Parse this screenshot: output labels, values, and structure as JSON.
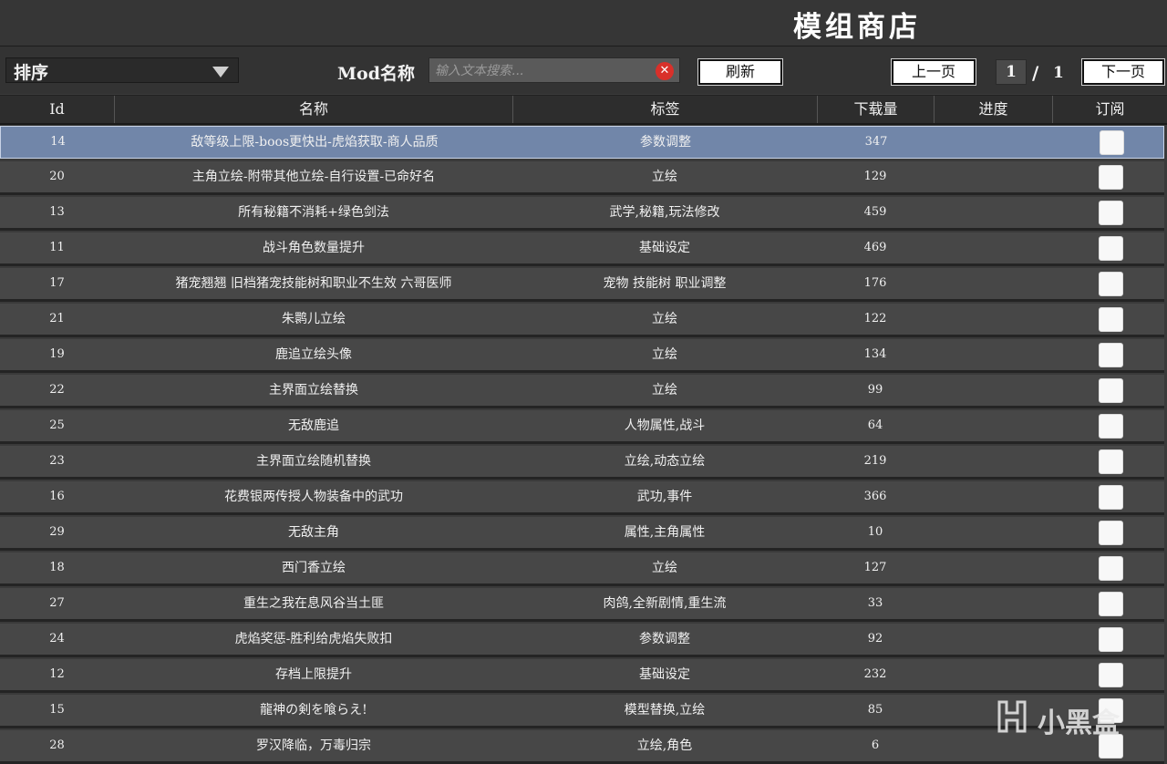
{
  "title": "模组商店",
  "toolbar": {
    "sort_label": "排序",
    "mod_label": "Mod名称",
    "search_placeholder": "输入文本搜索...",
    "refresh_label": "刷新",
    "prev_label": "上一页",
    "next_label": "下一页",
    "current_page": "1",
    "page_separator": "/",
    "total_pages": "1"
  },
  "columns": [
    "Id",
    "名称",
    "标签",
    "下载量",
    "进度",
    "订阅"
  ],
  "rows": [
    {
      "id": "14",
      "name": "敌等级上限-boos更快出-虎焰获取-商人品质",
      "tags": "参数调整",
      "downloads": "347",
      "progress": "",
      "subscribed": false,
      "selected": true
    },
    {
      "id": "20",
      "name": "主角立绘-附带其他立绘-自行设置-已命好名",
      "tags": "立绘",
      "downloads": "129",
      "progress": "",
      "subscribed": false
    },
    {
      "id": "13",
      "name": "所有秘籍不消耗+绿色剑法",
      "tags": "武学,秘籍,玩法修改",
      "downloads": "459",
      "progress": "",
      "subscribed": false
    },
    {
      "id": "11",
      "name": "战斗角色数量提升",
      "tags": "基础设定",
      "downloads": "469",
      "progress": "",
      "subscribed": false
    },
    {
      "id": "17",
      "name": "猪宠翘翘 旧档猪宠技能树和职业不生效 六哥医师",
      "tags": "宠物 技能树 职业调整",
      "downloads": "176",
      "progress": "",
      "subscribed": false
    },
    {
      "id": "21",
      "name": "朱鹮儿立绘",
      "tags": "立绘",
      "downloads": "122",
      "progress": "",
      "subscribed": false
    },
    {
      "id": "19",
      "name": "鹿追立绘头像",
      "tags": "立绘",
      "downloads": "134",
      "progress": "",
      "subscribed": false
    },
    {
      "id": "22",
      "name": "主界面立绘替换",
      "tags": "立绘",
      "downloads": "99",
      "progress": "",
      "subscribed": false
    },
    {
      "id": "25",
      "name": "无敌鹿追",
      "tags": "人物属性,战斗",
      "downloads": "64",
      "progress": "",
      "subscribed": false
    },
    {
      "id": "23",
      "name": "主界面立绘随机替换",
      "tags": "立绘,动态立绘",
      "downloads": "219",
      "progress": "",
      "subscribed": false
    },
    {
      "id": "16",
      "name": "花费银两传授人物装备中的武功",
      "tags": "武功,事件",
      "downloads": "366",
      "progress": "",
      "subscribed": false
    },
    {
      "id": "29",
      "name": "无敌主角",
      "tags": "属性,主角属性",
      "downloads": "10",
      "progress": "",
      "subscribed": false
    },
    {
      "id": "18",
      "name": "西门香立绘",
      "tags": "立绘",
      "downloads": "127",
      "progress": "",
      "subscribed": false
    },
    {
      "id": "27",
      "name": "重生之我在息风谷当土匪",
      "tags": "肉鸽,全新剧情,重生流",
      "downloads": "33",
      "progress": "",
      "subscribed": false
    },
    {
      "id": "24",
      "name": "虎焰奖惩-胜利给虎焰失败扣",
      "tags": "参数调整",
      "downloads": "92",
      "progress": "",
      "subscribed": false
    },
    {
      "id": "12",
      "name": "存档上限提升",
      "tags": "基础设定",
      "downloads": "232",
      "progress": "",
      "subscribed": false
    },
    {
      "id": "15",
      "name": "龍神の剣を喰らえ!",
      "tags": "模型替换,立绘",
      "downloads": "85",
      "progress": "",
      "subscribed": false
    },
    {
      "id": "28",
      "name": "罗汉降临，万毒归宗",
      "tags": "立绘,角色",
      "downloads": "6",
      "progress": "",
      "subscribed": false
    }
  ],
  "watermark": {
    "text": "小黑盒",
    "logo_icon": "heybox-logo-icon"
  },
  "colors": {
    "selected_row": "#7186a9",
    "row": "#474747",
    "background": "#3a3a3a",
    "clear_icon": "#d9302a"
  }
}
